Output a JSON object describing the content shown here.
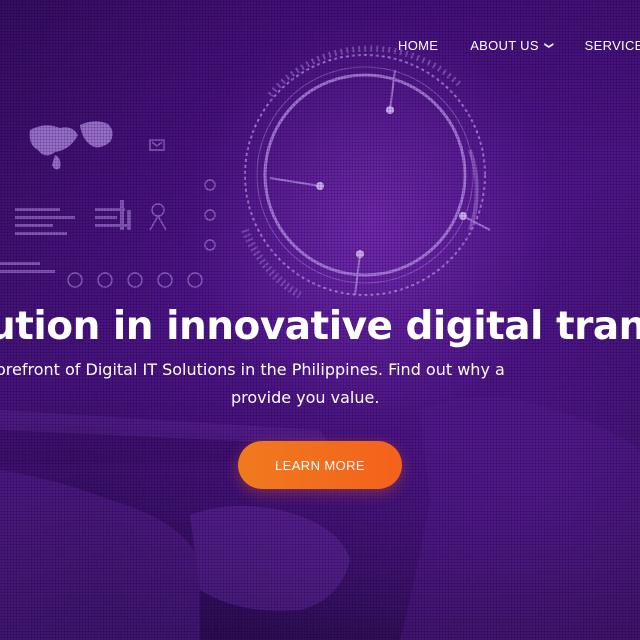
{
  "nav": {
    "items": [
      {
        "label": "HOME"
      },
      {
        "label": "ABOUT US",
        "dropdown": true
      },
      {
        "label": "SERVICE"
      }
    ]
  },
  "hero": {
    "headline": "ution in innovative digital transfo",
    "subtitle_line1": "orefront of Digital IT Solutions in the Philippines. Find out why a",
    "subtitle_line2": "provide you value.",
    "cta_label": "LEARN MORE"
  },
  "colors": {
    "background": "#4b1486",
    "accent": "#f07a1e",
    "text": "#ffffff"
  }
}
